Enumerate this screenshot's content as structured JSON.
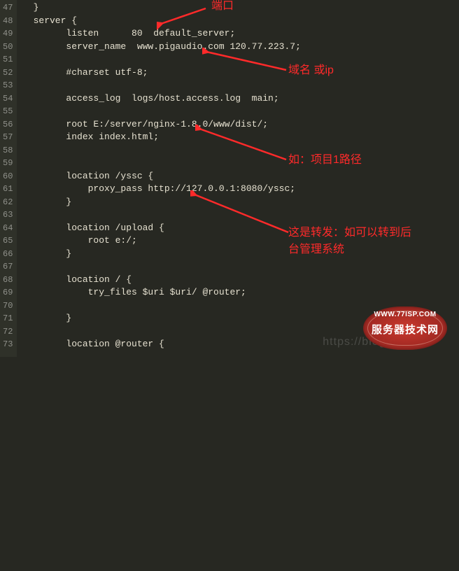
{
  "gutter": {
    "start": 47,
    "end": 73
  },
  "lines": [
    "  }",
    "  server {",
    "        listen      80  default_server;",
    "        server_name  www.pigaudio.com 120.77.223.7;",
    "",
    "        #charset utf-8;",
    "",
    "        access_log  logs/host.access.log  main;",
    "",
    "        root E:/server/nginx-1.8.0/www/dist/;",
    "        index index.html;",
    "",
    "",
    "        location /yssc {",
    "            proxy_pass http://127.0.0.1:8080/yssc;",
    "        }",
    "",
    "        location /upload {",
    "            root e:/;",
    "        }",
    "",
    "        location / {",
    "            try_files $uri $uri/ @router;",
    "",
    "        }",
    "",
    "        location @router {"
  ],
  "annotations": {
    "port": "端口",
    "domain": "域名 或ip",
    "path": "如：项目1路径",
    "proxy1": "这是转发：如可以转到后",
    "proxy2": "台管理系统"
  },
  "watermark": {
    "url": "https://blog.c",
    "badge_small": "WWW.77ISP.COM",
    "badge_big": "服务器技术网"
  }
}
